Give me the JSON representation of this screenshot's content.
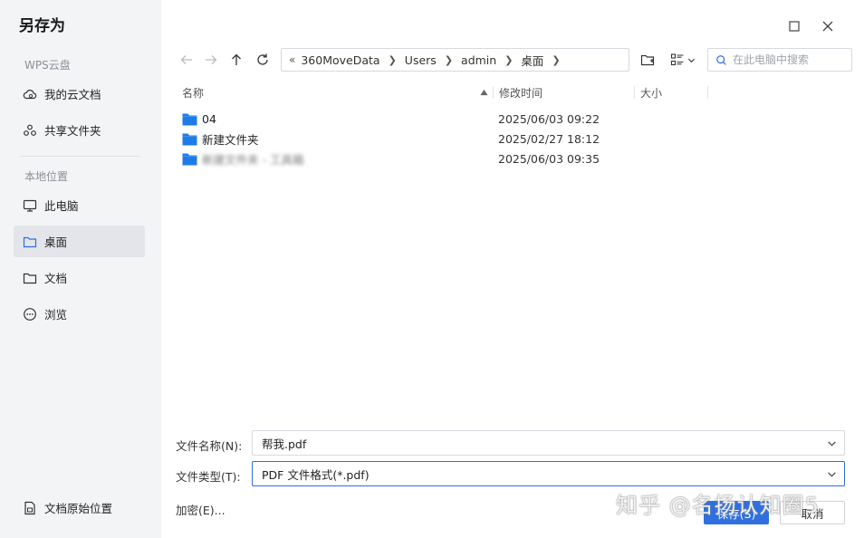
{
  "dialog": {
    "title": "另存为"
  },
  "sidebar": {
    "cloud_section": "WPS云盘",
    "cloud_items": [
      {
        "label": "我的云文档",
        "icon": "cloud-icon"
      },
      {
        "label": "共享文件夹",
        "icon": "share-folder-icon"
      }
    ],
    "local_section": "本地位置",
    "local_items": [
      {
        "label": "此电脑",
        "icon": "monitor-icon"
      },
      {
        "label": "桌面",
        "icon": "folder-icon",
        "active": true
      },
      {
        "label": "文档",
        "icon": "folder-icon"
      },
      {
        "label": "浏览",
        "icon": "more-icon"
      }
    ],
    "bottom_item": "文档原始位置"
  },
  "breadcrumb": [
    "360MoveData",
    "Users",
    "admin",
    "桌面"
  ],
  "search": {
    "placeholder": "在此电脑中搜索"
  },
  "columns": {
    "name": "名称",
    "modified": "修改时间",
    "size": "大小"
  },
  "files": [
    {
      "name": "04",
      "modified": "2025/06/03 09:22"
    },
    {
      "name": "新建文件夹",
      "modified": "2025/02/27 18:12"
    },
    {
      "name": "新建文件夹 - 工具箱",
      "modified": "2025/06/03 09:35",
      "blurred": true
    }
  ],
  "form": {
    "filename_label": "文件名称(N):",
    "filename_value": "帮我.pdf",
    "filetype_label": "文件类型(T):",
    "filetype_value": "PDF 文件格式(*.pdf)",
    "encrypt_label": "加密(E)...",
    "save_label": "保存(S)",
    "cancel_label": "取消"
  },
  "watermark": "知乎 @名扬认知圈5",
  "colors": {
    "accent": "#2f6fe0",
    "folder": "#1e7ce8",
    "sidebar_bg": "#f3f4f6"
  }
}
